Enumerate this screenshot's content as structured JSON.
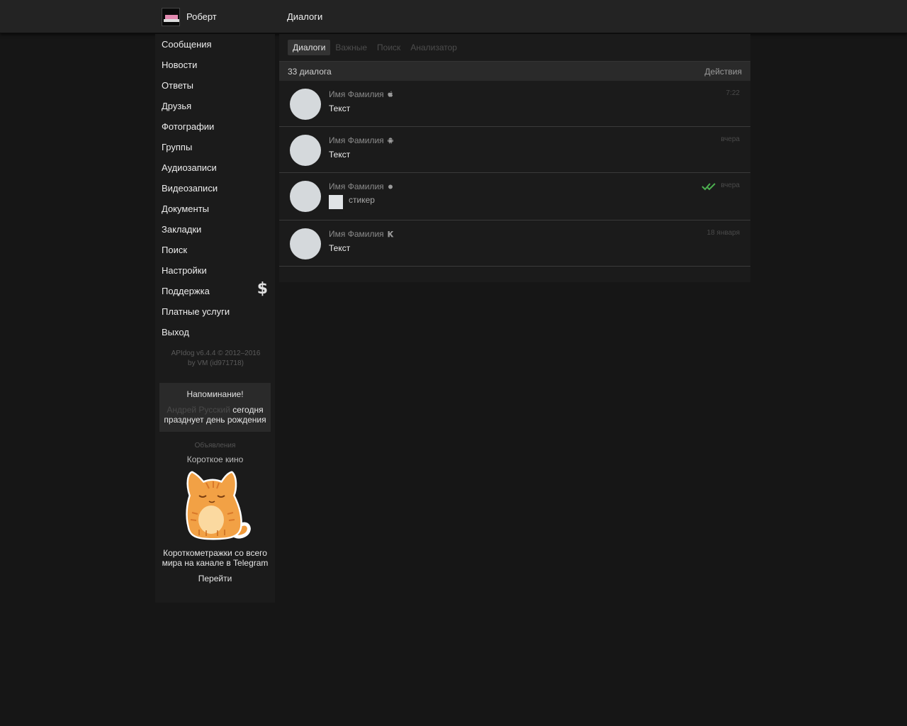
{
  "header": {
    "user_name": "Роберт",
    "page_title": "Диалоги"
  },
  "sidebar": {
    "items": [
      {
        "label": "Сообщения"
      },
      {
        "label": "Новости"
      },
      {
        "label": "Ответы"
      },
      {
        "label": "Друзья"
      },
      {
        "label": "Фотографии"
      },
      {
        "label": "Группы"
      },
      {
        "label": "Аудиозаписи"
      },
      {
        "label": "Видеозаписи"
      },
      {
        "label": "Документы"
      },
      {
        "label": "Закладки"
      },
      {
        "label": "Поиск"
      },
      {
        "label": "Настройки"
      },
      {
        "label": "Поддержка",
        "icon": "dollar-icon",
        "icon_glyph": "$"
      },
      {
        "label": "Платные услуги"
      },
      {
        "label": "Выход"
      }
    ],
    "copyright_line1": "APIdog v6.4.4 © 2012–2016",
    "copyright_line2": "by VM (id971718)"
  },
  "reminder": {
    "title": "Напоминание!",
    "name": "Андрей Русский",
    "text": " сегодня празднует день рождения"
  },
  "ads": {
    "label": "Объявления",
    "title": "Короткое кино",
    "text": "Короткометражки со всего мира на канале в Telegram",
    "link": "Перейти"
  },
  "tabs": [
    {
      "label": "Диалоги",
      "active": true
    },
    {
      "label": "Важные",
      "active": false
    },
    {
      "label": "Поиск",
      "active": false
    },
    {
      "label": "Анализатор",
      "active": false
    }
  ],
  "list": {
    "count": "33 диалога",
    "actions": "Действия"
  },
  "dialogs": [
    {
      "name": "Имя Фамилия",
      "platform_icon": "apple-icon",
      "time": "7:22",
      "message": "Текст"
    },
    {
      "name": "Имя Фамилия",
      "platform_icon": "android-icon",
      "time": "вчера",
      "message": "Текст"
    },
    {
      "name": "Имя Фамилия",
      "platform_icon": "online-dot-icon",
      "time": "вчера",
      "message": "стикер",
      "read_icon": "double-check-icon"
    },
    {
      "name": "Имя Фамилия",
      "platform_icon": "kate-mobile-icon",
      "time": "18 января",
      "message": "Текст"
    }
  ],
  "colors": {
    "background": "#161616",
    "panel": "#1b1b1b",
    "topbar": "#232323",
    "read_check": "#4caf50",
    "avatar_placeholder": "#d5d9dc"
  }
}
